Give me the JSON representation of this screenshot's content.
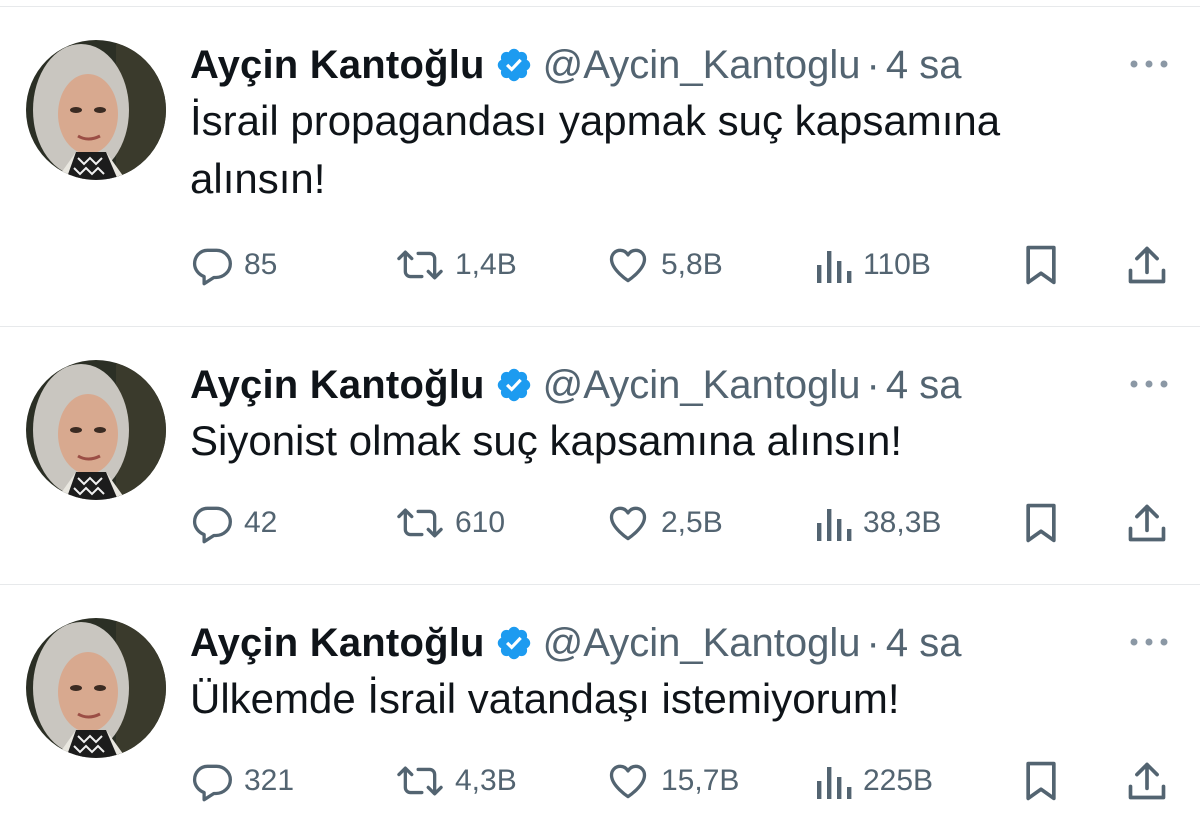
{
  "tweets": [
    {
      "author": "Ayçin Kantoğlu",
      "handle": "@Aycin_Kantoglu",
      "separator": "·",
      "time": "4 sa",
      "text": "İsrail propagandası yapmak suç kapsamına\nalınsın!",
      "replies": "85",
      "retweets": "1,4B",
      "likes": "5,8B",
      "views": "110B"
    },
    {
      "author": "Ayçin Kantoğlu",
      "handle": "@Aycin_Kantoglu",
      "separator": "·",
      "time": "4 sa",
      "text": "Siyonist olmak suç kapsamına alınsın!",
      "replies": "42",
      "retweets": "610",
      "likes": "2,5B",
      "views": "38,3B"
    },
    {
      "author": "Ayçin Kantoğlu",
      "handle": "@Aycin_Kantoglu",
      "separator": "·",
      "time": "4 sa",
      "text": "Ülkemde İsrail vatandaşı istemiyorum!",
      "replies": "321",
      "retweets": "4,3B",
      "likes": "15,7B",
      "views": "225B"
    }
  ],
  "icons": {
    "verified": "verified-badge-icon",
    "more": "more-dots-icon",
    "reply": "reply-icon",
    "retweet": "retweet-icon",
    "like": "heart-icon",
    "views": "views-bar-icon",
    "bookmark": "bookmark-icon",
    "share": "share-icon"
  },
  "colors": {
    "text": "#0f1419",
    "secondary": "#536471",
    "verified": "#1d9bf0",
    "divider": "#e7e9eb"
  }
}
